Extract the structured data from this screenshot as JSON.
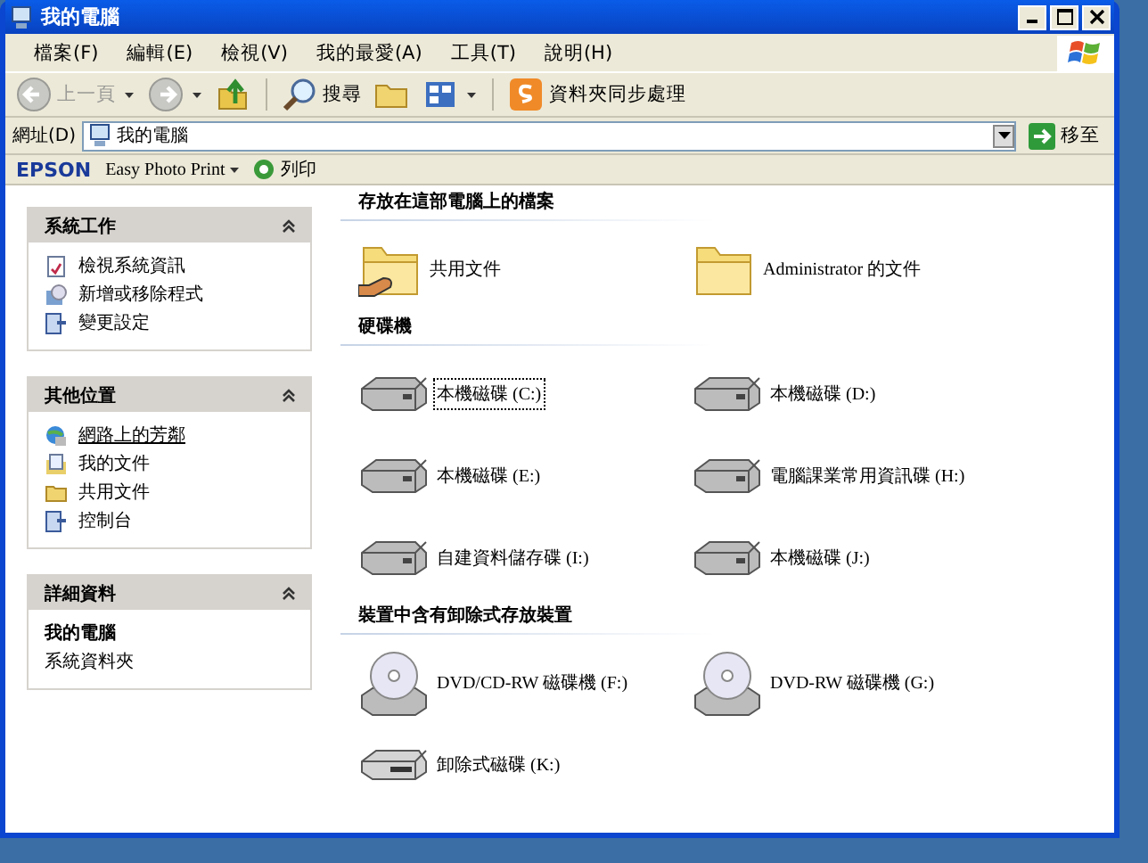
{
  "window": {
    "title": "我的電腦"
  },
  "menu": [
    "檔案(F)",
    "編輯(E)",
    "檢視(V)",
    "我的最愛(A)",
    "工具(T)",
    "說明(H)"
  ],
  "toolbar": [
    {
      "kind": "back",
      "label": "上一頁",
      "disabled": true
    },
    {
      "kind": "forward",
      "disabled": true
    },
    {
      "kind": "up"
    },
    {
      "kind": "search",
      "label": "搜尋"
    },
    {
      "kind": "folders"
    },
    {
      "kind": "views"
    },
    {
      "kind": "sync",
      "label": "資料夾同步處理"
    }
  ],
  "address": {
    "label": "網址(D)",
    "value": "我的電腦",
    "go": "移至"
  },
  "epson": {
    "brand": "EPSON",
    "app": "Easy Photo Print",
    "print": "列印"
  },
  "panels": [
    {
      "title": "系統工作",
      "expanded": true,
      "links": [
        {
          "kind": "info",
          "label": "檢視系統資訊",
          "hovered": false
        },
        {
          "kind": "programs",
          "label": "新增或移除程式",
          "hovered": false
        },
        {
          "kind": "settings",
          "label": "變更設定",
          "hovered": false
        }
      ]
    },
    {
      "title": "其他位置",
      "expanded": true,
      "links": [
        {
          "kind": "network",
          "label": "網路上的芳鄰",
          "hovered": true
        },
        {
          "kind": "documents",
          "label": "我的文件",
          "hovered": false
        },
        {
          "kind": "folder",
          "label": "共用文件",
          "hovered": false
        },
        {
          "kind": "settings",
          "label": "控制台",
          "hovered": false
        }
      ]
    },
    {
      "title": "詳細資料",
      "expanded": true,
      "details": {
        "name": "我的電腦",
        "type": "系統資料夾"
      }
    }
  ],
  "groups": [
    {
      "title": "存放在這部電腦上的檔案",
      "items": [
        {
          "kind": "shared-folder",
          "label": "共用文件",
          "selected": false
        },
        {
          "kind": "folder",
          "label": "Administrator 的文件",
          "selected": false
        }
      ]
    },
    {
      "title": "硬碟機",
      "items": [
        {
          "kind": "disk",
          "label": "本機磁碟 (C:)",
          "selected": true
        },
        {
          "kind": "disk",
          "label": "本機磁碟 (D:)",
          "selected": false
        },
        {
          "kind": "disk",
          "label": "本機磁碟 (E:)",
          "selected": false
        },
        {
          "kind": "disk",
          "label": "電腦課業常用資訊碟 (H:)",
          "selected": false
        },
        {
          "kind": "disk",
          "label": "自建資料儲存碟 (I:)",
          "selected": false
        },
        {
          "kind": "disk",
          "label": "本機磁碟 (J:)",
          "selected": false
        }
      ]
    },
    {
      "title": "裝置中含有卸除式存放裝置",
      "items": [
        {
          "kind": "dvd",
          "label": "DVD/CD-RW 磁碟機 (F:)",
          "selected": false
        },
        {
          "kind": "dvd",
          "label": "DVD-RW 磁碟機 (G:)",
          "selected": false
        },
        {
          "kind": "removable",
          "label": "卸除式磁碟 (K:)",
          "selected": false
        }
      ]
    }
  ]
}
